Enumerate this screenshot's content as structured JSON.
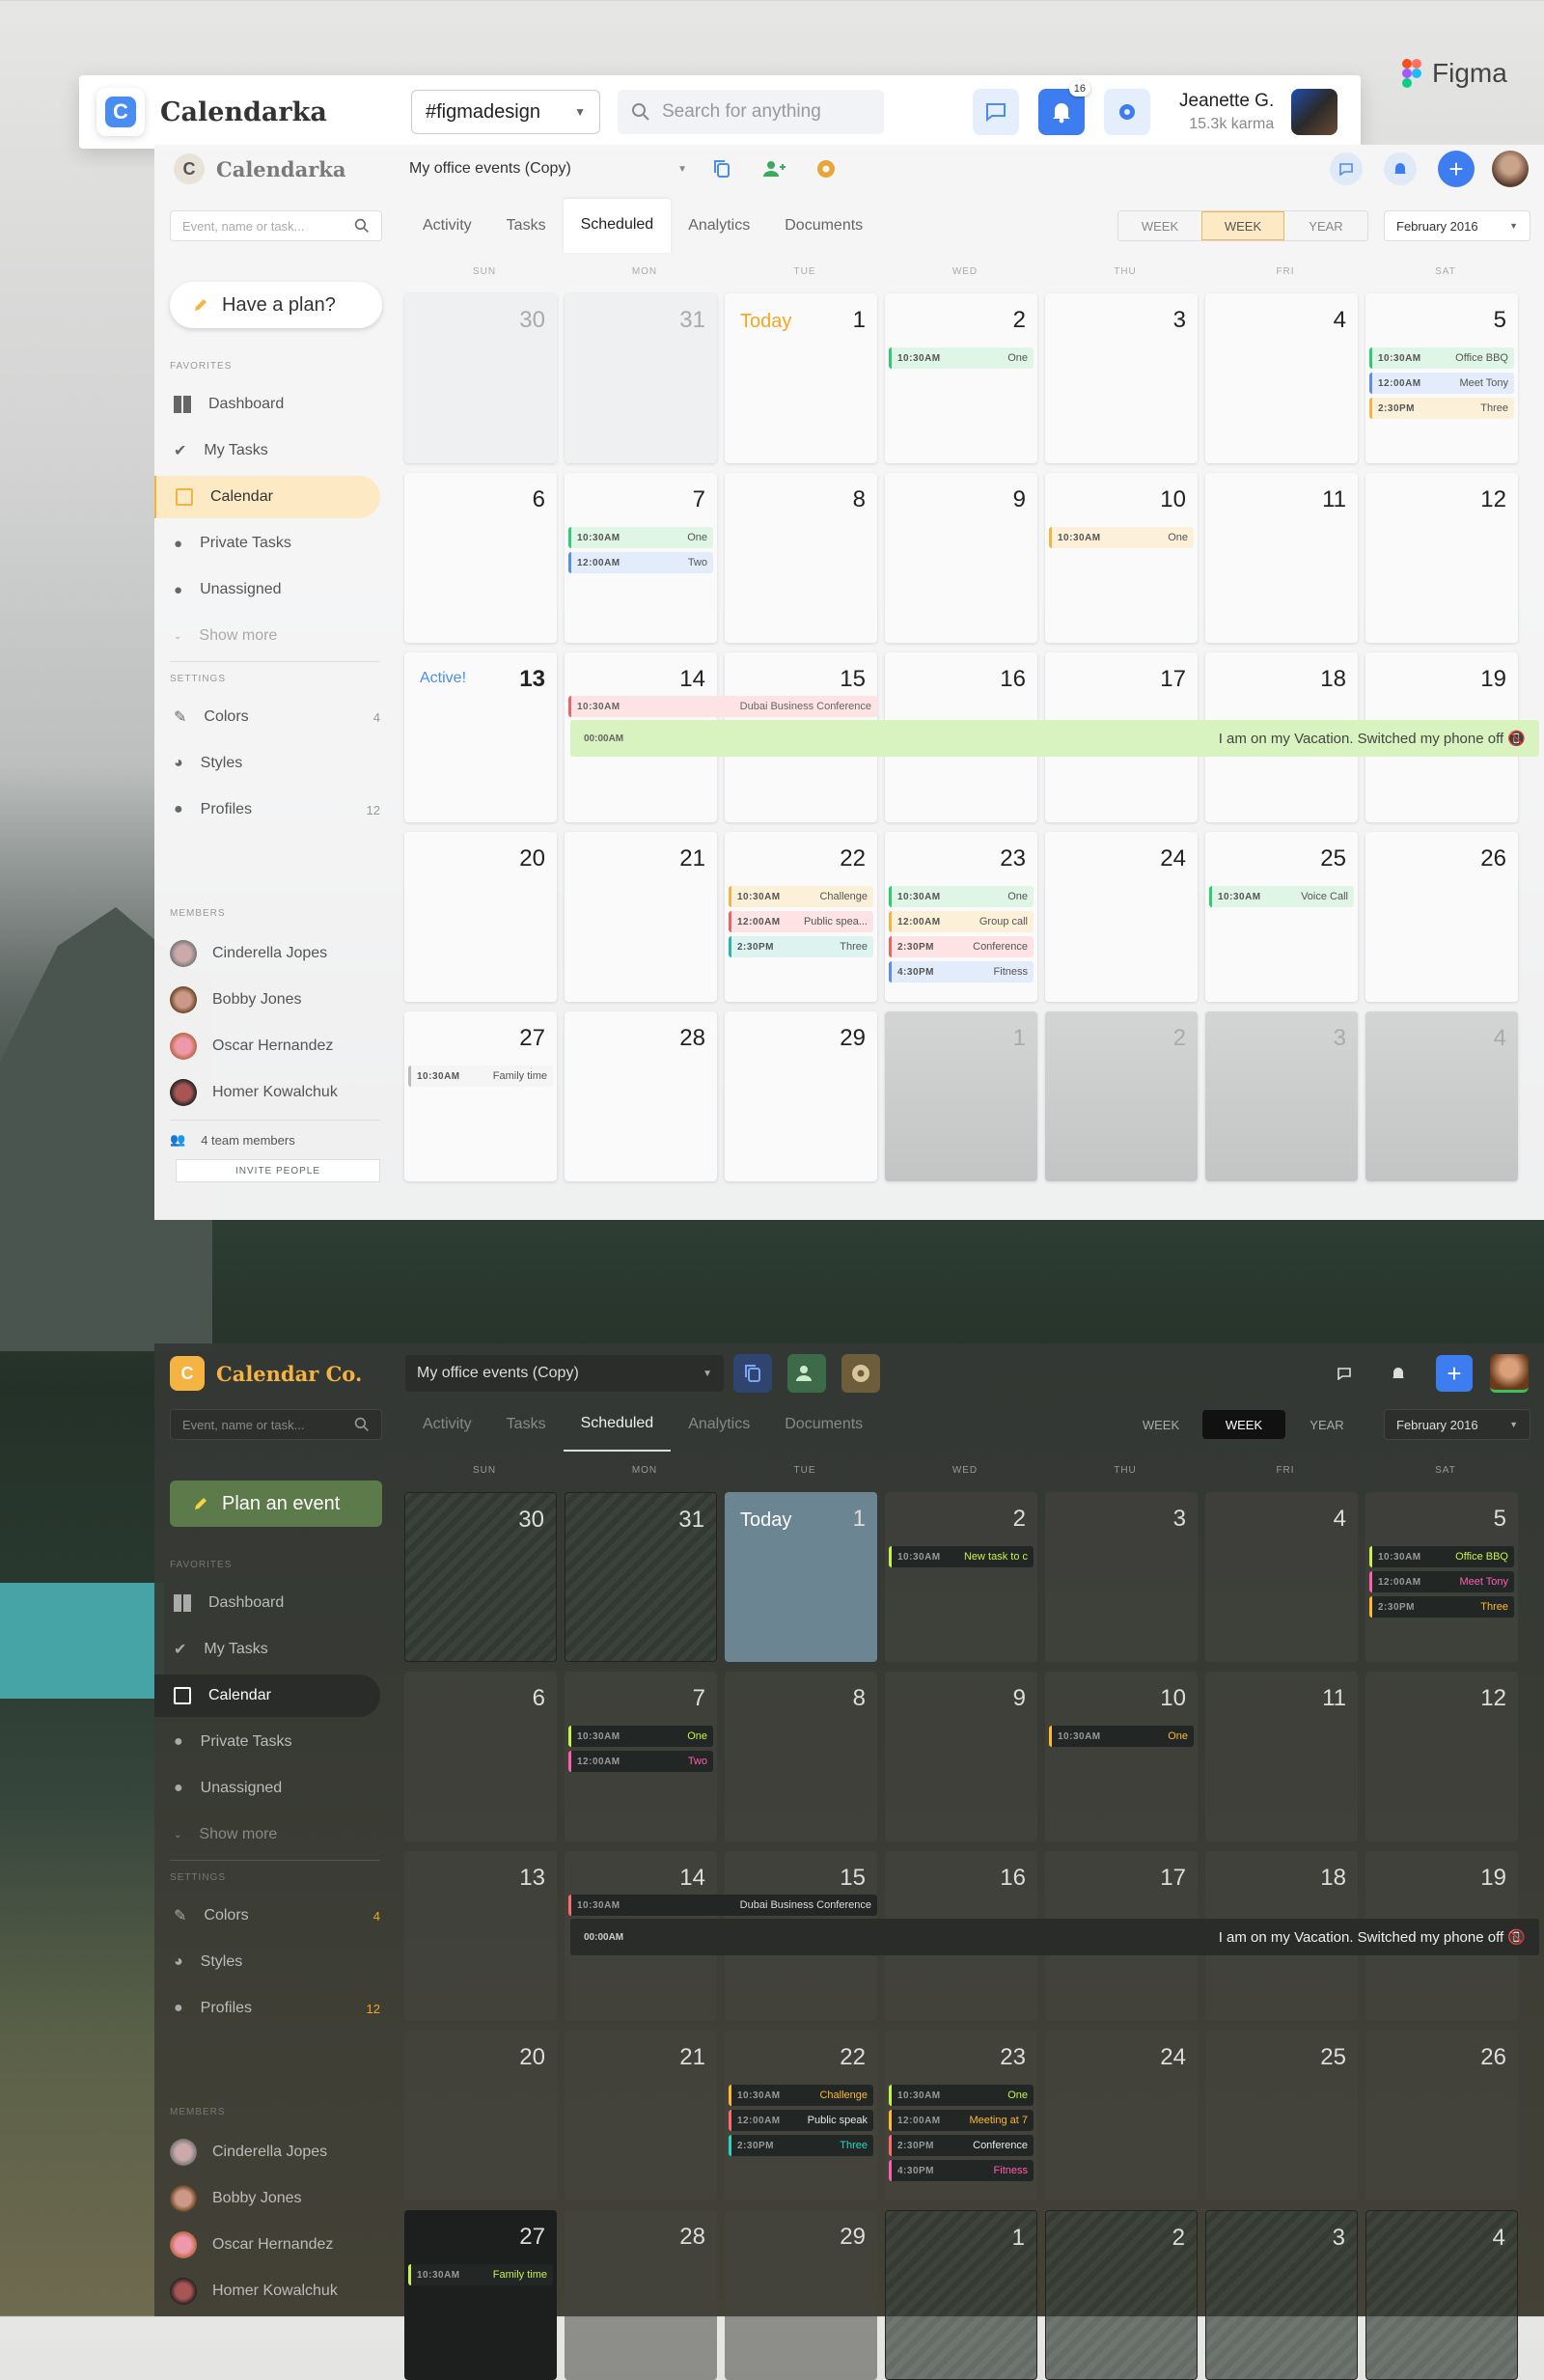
{
  "figma_header": {
    "app_name": "Calendarka",
    "channel": "#figmadesign",
    "search_placeholder": "Search for anything",
    "notif_count": "16",
    "user_name": "Jeanette G.",
    "user_karma": "15.3k karma",
    "figma_label": "Figma"
  },
  "light": {
    "brand": "Calendarka",
    "logo_letter": "C",
    "calendar_select": "My office events (Copy)",
    "search_placeholder": "Event, name or task...",
    "tabs": [
      "Activity",
      "Tasks",
      "Scheduled",
      "Analytics",
      "Documents"
    ],
    "views": [
      "WEEK",
      "WEEK",
      "YEAR"
    ],
    "month": "February 2016",
    "plan_button": "Have a plan?",
    "favorites_label": "FAVORITES",
    "nav": [
      "Dashboard",
      "My Tasks",
      "Calendar",
      "Private Tasks",
      "Unassigned",
      "Show more"
    ],
    "settings_label": "SETTINGS",
    "settings": [
      {
        "label": "Colors",
        "count": "4"
      },
      {
        "label": "Styles",
        "count": ""
      },
      {
        "label": "Profiles",
        "count": "12"
      }
    ],
    "members_label": "MEMBERS",
    "members": [
      "Cinderella Jopes",
      "Bobby Jones",
      "Oscar Hernandez",
      "Homer Kowalchuk"
    ],
    "team_count": "4 team members",
    "invite": "INVITE PEOPLE",
    "today_label": "Today",
    "active_label": "Active!",
    "weekdays": [
      "SUN",
      "MON",
      "TUE",
      "WED",
      "THU",
      "FRI",
      "SAT"
    ],
    "vacation": {
      "time": "00:00AM",
      "text": "I am on my Vacation. Switched my phone off 📵"
    }
  },
  "dark": {
    "brand": "Calendar Co.",
    "logo_letter": "C",
    "calendar_select": "My office events (Copy)",
    "search_placeholder": "Event, name or task...",
    "tabs": [
      "Activity",
      "Tasks",
      "Scheduled",
      "Analytics",
      "Documents"
    ],
    "views": [
      "WEEK",
      "WEEK",
      "YEAR"
    ],
    "month": "February 2016",
    "plan_button": "Plan an event",
    "favorites_label": "FAVORITES",
    "nav": [
      "Dashboard",
      "My Tasks",
      "Calendar",
      "Private Tasks",
      "Unassigned",
      "Show more"
    ],
    "settings_label": "SETTINGS",
    "settings": [
      {
        "label": "Colors",
        "count": "4"
      },
      {
        "label": "Styles",
        "count": ""
      },
      {
        "label": "Profiles",
        "count": "12"
      }
    ],
    "members_label": "MEMBERS",
    "members": [
      "Cinderella Jopes",
      "Bobby Jones",
      "Oscar Hernandez",
      "Homer Kowalchuk"
    ],
    "today_label": "Today",
    "weekdays": [
      "SUN",
      "MON",
      "TUE",
      "WED",
      "THU",
      "FRI",
      "SAT"
    ],
    "vacation": {
      "time": "00:00AM",
      "text": "I am on my Vacation. Switched my phone off 📵"
    }
  },
  "light_days": [
    {
      "n": "30",
      "kind": "muted",
      "ev": []
    },
    {
      "n": "31",
      "kind": "muted",
      "ev": []
    },
    {
      "n": "1",
      "kind": "today",
      "ev": []
    },
    {
      "n": "2",
      "kind": "",
      "ev": [
        {
          "t": "10:30AM",
          "l": "One",
          "c": "#2ecc71",
          "bg": "#dff5e6"
        }
      ]
    },
    {
      "n": "3",
      "kind": "",
      "ev": []
    },
    {
      "n": "4",
      "kind": "",
      "ev": []
    },
    {
      "n": "5",
      "kind": "",
      "ev": [
        {
          "t": "10:30AM",
          "l": "Office BBQ",
          "c": "#2ecc71",
          "bg": "#dff5e6"
        },
        {
          "t": "12:00AM",
          "l": "Meet Tony",
          "c": "#5b8def",
          "bg": "#e2ecfb"
        },
        {
          "t": "2:30PM",
          "l": "Three",
          "c": "#f5b342",
          "bg": "#fdf0d8"
        }
      ]
    },
    {
      "n": "6",
      "kind": "",
      "ev": []
    },
    {
      "n": "7",
      "kind": "",
      "ev": [
        {
          "t": "10:30AM",
          "l": "One",
          "c": "#2ecc71",
          "bg": "#dff5e6"
        },
        {
          "t": "12:00AM",
          "l": "Two",
          "c": "#5b8def",
          "bg": "#e2ecfb"
        }
      ]
    },
    {
      "n": "8",
      "kind": "",
      "ev": []
    },
    {
      "n": "9",
      "kind": "",
      "ev": []
    },
    {
      "n": "10",
      "kind": "",
      "ev": [
        {
          "t": "10:30AM",
          "l": "One",
          "c": "#f5b342",
          "bg": "#fdf0d8"
        }
      ]
    },
    {
      "n": "11",
      "kind": "",
      "ev": []
    },
    {
      "n": "12",
      "kind": "",
      "ev": []
    },
    {
      "n": "13",
      "kind": "active",
      "ev": []
    },
    {
      "n": "14",
      "kind": "",
      "ev": []
    },
    {
      "n": "15",
      "kind": "",
      "ev": []
    },
    {
      "n": "16",
      "kind": "",
      "ev": []
    },
    {
      "n": "17",
      "kind": "",
      "ev": []
    },
    {
      "n": "18",
      "kind": "",
      "ev": []
    },
    {
      "n": "19",
      "kind": "",
      "ev": []
    },
    {
      "n": "20",
      "kind": "",
      "ev": []
    },
    {
      "n": "21",
      "kind": "",
      "ev": []
    },
    {
      "n": "22",
      "kind": "",
      "ev": [
        {
          "t": "10:30AM",
          "l": "Challenge",
          "c": "#f5b342",
          "bg": "#fdf0d8"
        },
        {
          "t": "12:00AM",
          "l": "Public spea...",
          "c": "#f06262",
          "bg": "#fde3e3"
        },
        {
          "t": "2:30PM",
          "l": "Three",
          "c": "#2bb5a6",
          "bg": "#dcf3f0"
        }
      ]
    },
    {
      "n": "23",
      "kind": "",
      "ev": [
        {
          "t": "10:30AM",
          "l": "One",
          "c": "#2ecc71",
          "bg": "#dff5e6"
        },
        {
          "t": "12:00AM",
          "l": "Group call",
          "c": "#f5b342",
          "bg": "#fdf0d8"
        },
        {
          "t": "2:30PM",
          "l": "Conference",
          "c": "#f06262",
          "bg": "#fde3e3"
        },
        {
          "t": "4:30PM",
          "l": "Fitness",
          "c": "#5b8def",
          "bg": "#e2ecfb"
        }
      ]
    },
    {
      "n": "24",
      "kind": "",
      "ev": []
    },
    {
      "n": "25",
      "kind": "",
      "ev": [
        {
          "t": "10:30AM",
          "l": "Voice Call",
          "c": "#2ecc71",
          "bg": "#dff5e6"
        }
      ]
    },
    {
      "n": "26",
      "kind": "",
      "ev": []
    },
    {
      "n": "27",
      "kind": "",
      "ev": [
        {
          "t": "10:30AM",
          "l": "Family time",
          "c": "#bbbbbb",
          "bg": "#f5f5f5"
        }
      ]
    },
    {
      "n": "28",
      "kind": "",
      "ev": []
    },
    {
      "n": "29",
      "kind": "",
      "ev": []
    },
    {
      "n": "1",
      "kind": "future",
      "ev": []
    },
    {
      "n": "2",
      "kind": "future",
      "ev": []
    },
    {
      "n": "3",
      "kind": "future",
      "ev": []
    },
    {
      "n": "4",
      "kind": "future",
      "ev": []
    }
  ],
  "light_span_event": {
    "t": "10:30AM",
    "l": "Dubai Business Conference"
  },
  "dark_days": [
    {
      "n": "30",
      "kind": "hatch",
      "ev": []
    },
    {
      "n": "31",
      "kind": "hatch",
      "ev": []
    },
    {
      "n": "1",
      "kind": "today",
      "ev": []
    },
    {
      "n": "2",
      "kind": "",
      "ev": [
        {
          "t": "10:30AM",
          "l": "New task to c",
          "c": "#c6f24a",
          "lc": "#c6f24a"
        }
      ]
    },
    {
      "n": "3",
      "kind": "",
      "ev": []
    },
    {
      "n": "4",
      "kind": "",
      "ev": []
    },
    {
      "n": "5",
      "kind": "",
      "ev": [
        {
          "t": "10:30AM",
          "l": "Office BBQ",
          "c": "#c6f24a",
          "lc": "#c6f24a"
        },
        {
          "t": "12:00AM",
          "l": "Meet Tony",
          "c": "#ff5fb0",
          "lc": "#ff5fb0"
        },
        {
          "t": "2:30PM",
          "l": "Three",
          "c": "#ffb830",
          "lc": "#ffb830"
        }
      ]
    },
    {
      "n": "6",
      "kind": "",
      "ev": []
    },
    {
      "n": "7",
      "kind": "",
      "ev": [
        {
          "t": "10:30AM",
          "l": "One",
          "c": "#c6f24a",
          "lc": "#c6f24a"
        },
        {
          "t": "12:00AM",
          "l": "Two",
          "c": "#ff5fb0",
          "lc": "#ff5fb0"
        }
      ]
    },
    {
      "n": "8",
      "kind": "",
      "ev": []
    },
    {
      "n": "9",
      "kind": "",
      "ev": []
    },
    {
      "n": "10",
      "kind": "",
      "ev": [
        {
          "t": "10:30AM",
          "l": "One",
          "c": "#ffb830",
          "lc": "#ffb830"
        }
      ]
    },
    {
      "n": "11",
      "kind": "",
      "ev": []
    },
    {
      "n": "12",
      "kind": "",
      "ev": []
    },
    {
      "n": "13",
      "kind": "",
      "ev": []
    },
    {
      "n": "14",
      "kind": "",
      "ev": []
    },
    {
      "n": "15",
      "kind": "",
      "ev": []
    },
    {
      "n": "16",
      "kind": "",
      "ev": []
    },
    {
      "n": "17",
      "kind": "",
      "ev": []
    },
    {
      "n": "18",
      "kind": "",
      "ev": []
    },
    {
      "n": "19",
      "kind": "",
      "ev": []
    },
    {
      "n": "20",
      "kind": "",
      "ev": []
    },
    {
      "n": "21",
      "kind": "",
      "ev": []
    },
    {
      "n": "22",
      "kind": "",
      "ev": [
        {
          "t": "10:30AM",
          "l": "Challenge",
          "c": "#ffb830",
          "lc": "#ffb830"
        },
        {
          "t": "12:00AM",
          "l": "Public speak",
          "c": "#ff6b6b",
          "lc": "#e8e8e8"
        },
        {
          "t": "2:30PM",
          "l": "Three",
          "c": "#2bd4c4",
          "lc": "#2bd4c4"
        }
      ]
    },
    {
      "n": "23",
      "kind": "",
      "ev": [
        {
          "t": "10:30AM",
          "l": "One",
          "c": "#c6f24a",
          "lc": "#c6f24a"
        },
        {
          "t": "12:00AM",
          "l": "Meeting at 7",
          "c": "#ffb830",
          "lc": "#ffb830"
        },
        {
          "t": "2:30PM",
          "l": "Conference",
          "c": "#ff6b6b",
          "lc": "#e8e8e8"
        },
        {
          "t": "4:30PM",
          "l": "Fitness",
          "c": "#ff5fb0",
          "lc": "#ff5fb0"
        }
      ]
    },
    {
      "n": "24",
      "kind": "",
      "ev": []
    },
    {
      "n": "25",
      "kind": "",
      "ev": []
    },
    {
      "n": "26",
      "kind": "",
      "ev": []
    },
    {
      "n": "27",
      "kind": "black",
      "ev": [
        {
          "t": "10:30AM",
          "l": "Family time",
          "c": "#c6f24a",
          "lc": "#c6f24a"
        }
      ]
    },
    {
      "n": "28",
      "kind": "",
      "ev": []
    },
    {
      "n": "29",
      "kind": "",
      "ev": []
    },
    {
      "n": "1",
      "kind": "hatch",
      "ev": []
    },
    {
      "n": "2",
      "kind": "hatch",
      "ev": []
    },
    {
      "n": "3",
      "kind": "hatch",
      "ev": []
    },
    {
      "n": "4",
      "kind": "hatch",
      "ev": []
    }
  ],
  "dark_span_event": {
    "t": "10:30AM",
    "l": "Dubai Business Conference"
  },
  "colors": {
    "accent": "#4a8df0",
    "light_active_nav": "#fde9c4",
    "dark_plan": "#5c7a4a",
    "dark_accent_count": "#f5a623"
  }
}
